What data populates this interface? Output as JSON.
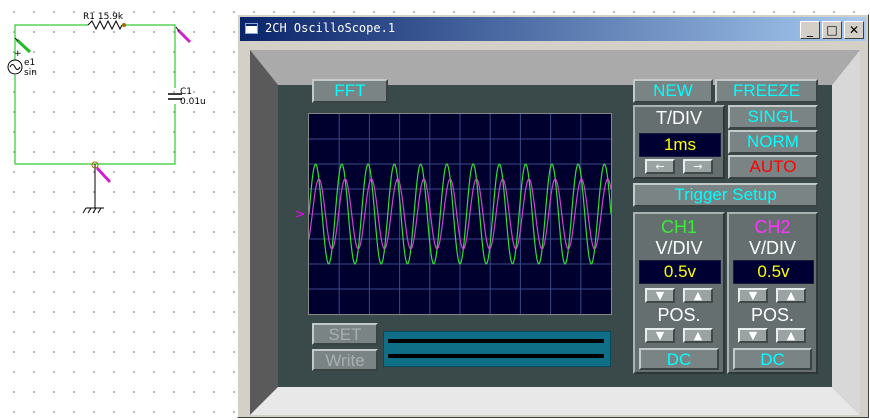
{
  "schematic": {
    "resistor_label": "R1 15.9k",
    "source_name": "e1",
    "source_type": "sin",
    "source_plus": "+",
    "capacitor_name": "C1",
    "capacitor_value": "0.01u"
  },
  "window": {
    "title": "2CH OscilloScope.1",
    "minimize": "_",
    "maximize": "□",
    "close": "✕"
  },
  "scope": {
    "fft_label": "FFT",
    "new_label": "NEW",
    "freeze_label": "FREEZE",
    "tdiv_label": "T/DIV",
    "tdiv_value": "1ms",
    "singl_label": "SINGL",
    "norm_label": "NORM",
    "auto_label": "AUTO",
    "trigger_label": "Trigger Setup",
    "ch1": {
      "title": "CH1",
      "vdiv_label": "V/DIV",
      "vdiv_value": "0.5v",
      "pos_label": "POS.",
      "coupling": "DC"
    },
    "ch2": {
      "title": "CH2",
      "vdiv_label": "V/DIV",
      "vdiv_value": "0.5v",
      "pos_label": "POS.",
      "coupling": "DC"
    },
    "set_label": "SET",
    "write_label": "Write",
    "arrow_left": "←",
    "arrow_right": "→",
    "arrow_down": "▼",
    "arrow_up": "▲",
    "trace_marker": ">",
    "colors": {
      "ch1": "#33dd33",
      "ch2": "#cc44cc",
      "grid": "#3a4a8a",
      "accent": "#00ffff"
    }
  }
}
